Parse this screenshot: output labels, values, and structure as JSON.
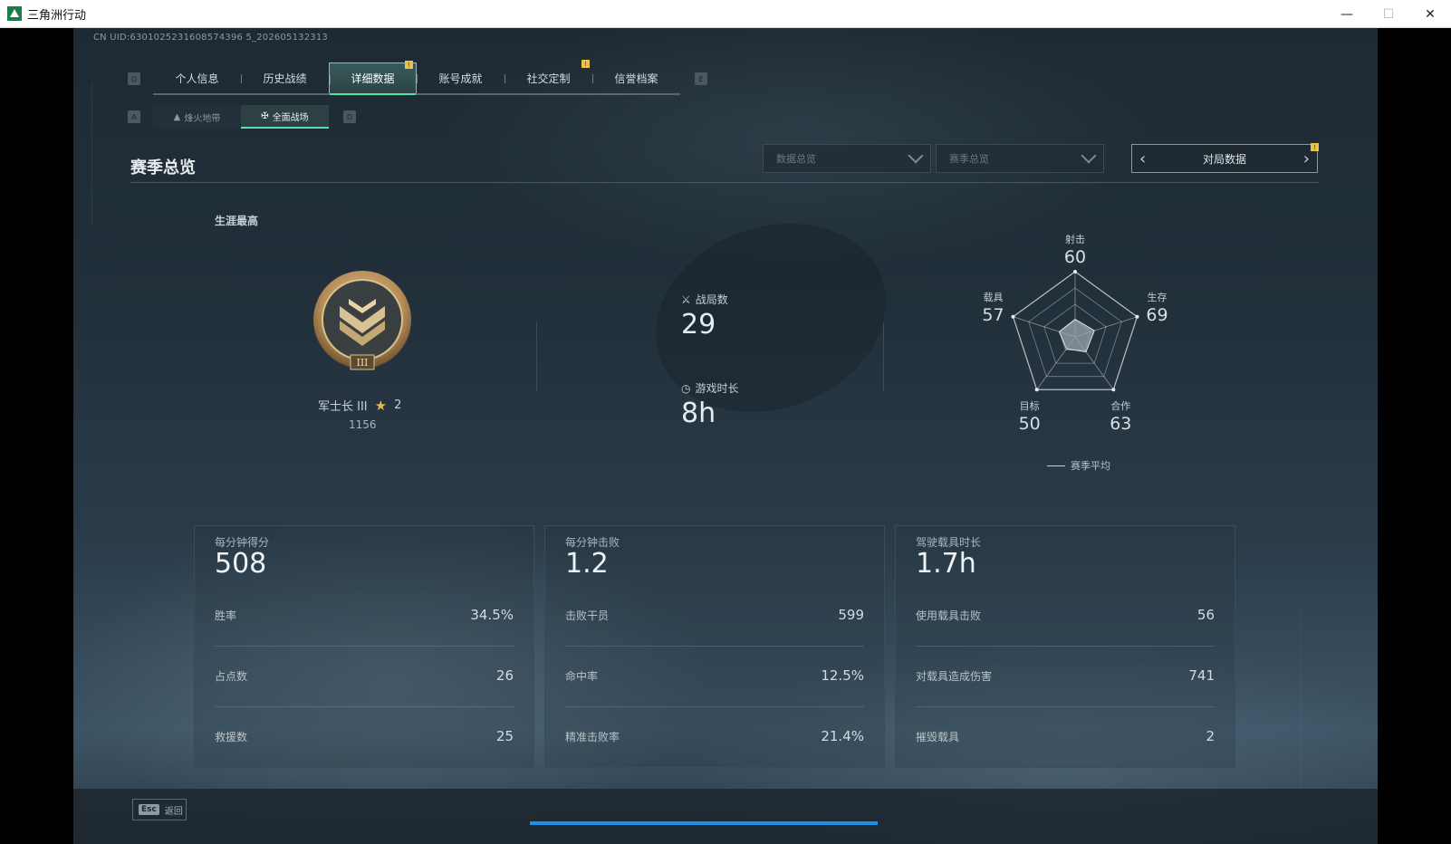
{
  "window": {
    "title": "三角洲行动"
  },
  "uid": "CN UID:6301025231608574396 5_202605132313",
  "nav": {
    "left_key": "Q",
    "right_key": "E",
    "tabs": [
      {
        "label": "个人信息"
      },
      {
        "label": "历史战绩"
      },
      {
        "label": "详细数据",
        "active": true,
        "badge": "!"
      },
      {
        "label": "账号成就"
      },
      {
        "label": "社交定制",
        "badge": "!"
      },
      {
        "label": "信誉档案"
      }
    ]
  },
  "subnav": {
    "left_key": "A",
    "right_key": "D",
    "tabs": [
      {
        "label": "烽火地带",
        "icon": "mountain-icon"
      },
      {
        "label": "全面战场",
        "icon": "crossed-flag-icon",
        "active": true
      }
    ]
  },
  "section": {
    "title": "赛季总览"
  },
  "filters": {
    "dropdown1": "数据总览",
    "dropdown2": "赛季总览",
    "pager_label": "对局数据",
    "pager_badge": "!"
  },
  "career": {
    "label": "生涯最高",
    "rank_name": "军士长 III",
    "stars": "2",
    "score": "1156"
  },
  "summary": {
    "matches_label": "战局数",
    "matches_value": "29",
    "time_label": "游戏时长",
    "time_value": "8h"
  },
  "radar": {
    "axes": [
      {
        "label": "射击",
        "value": 60
      },
      {
        "label": "生存",
        "value": 69
      },
      {
        "label": "合作",
        "value": 63
      },
      {
        "label": "目标",
        "value": 50
      },
      {
        "label": "载具",
        "value": 57
      }
    ],
    "shape_color": "#9aa5ab",
    "legend": "赛季平均"
  },
  "cards": [
    {
      "title": "每分钟得分",
      "value": "508",
      "rows": [
        {
          "label": "胜率",
          "value": "34.5%"
        },
        {
          "label": "占点数",
          "value": "26"
        },
        {
          "label": "救援数",
          "value": "25"
        }
      ]
    },
    {
      "title": "每分钟击败",
      "value": "1.2",
      "rows": [
        {
          "label": "击败干员",
          "value": "599"
        },
        {
          "label": "命中率",
          "value": "12.5%"
        },
        {
          "label": "精准击败率",
          "value": "21.4%"
        }
      ]
    },
    {
      "title": "驾驶载具时长",
      "value": "1.7h",
      "rows": [
        {
          "label": "使用载具击败",
          "value": "56"
        },
        {
          "label": "对载具造成伤害",
          "value": "741"
        },
        {
          "label": "摧毁载具",
          "value": "2"
        }
      ]
    }
  ],
  "footer": {
    "esc_key": "Esc",
    "esc_label": "返回",
    "progress": 1.0
  },
  "colors": {
    "accent": "#58e0a8",
    "badge": "#e8c34c",
    "progress": "#1e90e6"
  }
}
